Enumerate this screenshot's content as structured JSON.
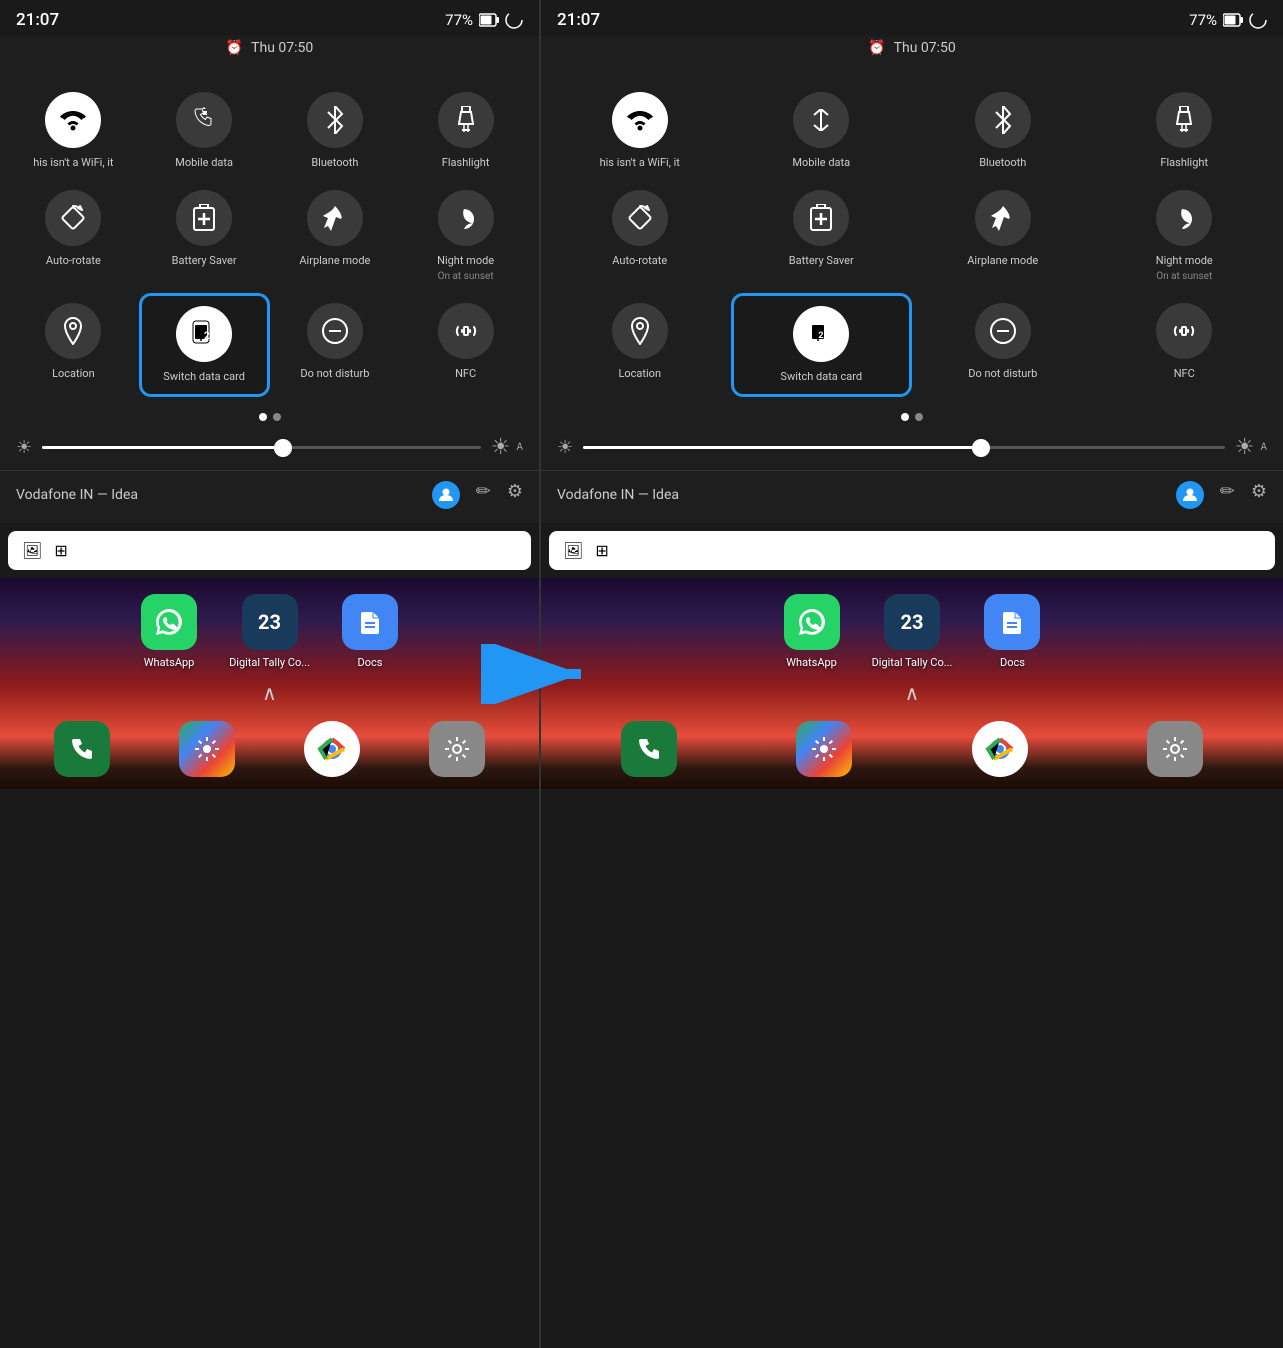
{
  "left": {
    "status": {
      "time": "21:07",
      "battery": "77%"
    },
    "alarm": {
      "time": "Thu 07:50"
    },
    "quickSettings": [
      {
        "id": "wifi",
        "icon": "wifi",
        "label": "his isn't a WiFi, it",
        "active": true
      },
      {
        "id": "mobile-data",
        "icon": "mobile",
        "label": "Mobile data",
        "active": false
      },
      {
        "id": "bluetooth",
        "icon": "bluetooth",
        "label": "Bluetooth",
        "active": false
      },
      {
        "id": "flashlight",
        "icon": "flashlight",
        "label": "Flashlight",
        "active": false
      },
      {
        "id": "auto-rotate",
        "icon": "rotate",
        "label": "Auto-rotate",
        "active": false
      },
      {
        "id": "battery-saver",
        "icon": "battery",
        "label": "Battery Saver",
        "active": false
      },
      {
        "id": "airplane",
        "icon": "airplane",
        "label": "Airplane mode",
        "active": false
      },
      {
        "id": "night-mode",
        "icon": "moon",
        "label": "Night mode",
        "sublabel": "On at sunset",
        "active": false
      },
      {
        "id": "location",
        "icon": "location",
        "label": "Location",
        "active": false
      },
      {
        "id": "switch-data",
        "icon": "sim",
        "label": "Switch data card",
        "active": true,
        "highlight": true
      },
      {
        "id": "dnd",
        "icon": "dnd",
        "label": "Do not disturb",
        "active": false
      },
      {
        "id": "nfc",
        "icon": "nfc",
        "label": "NFC",
        "active": false
      }
    ],
    "brightness": 55,
    "account": "Vodafone IN — Idea",
    "apps": [
      {
        "id": "whatsapp",
        "label": "WhatsApp"
      },
      {
        "id": "tally",
        "label": "Digital Tally Co..."
      },
      {
        "id": "docs",
        "label": "Docs"
      }
    ],
    "dock": [
      "Phone",
      "Photos",
      "Chrome",
      "Settings"
    ]
  },
  "right": {
    "status": {
      "time": "21:07",
      "battery": "77%"
    },
    "alarm": {
      "time": "Thu 07:50"
    },
    "quickSettings": [
      {
        "id": "wifi",
        "icon": "wifi",
        "label": "his isn't a WiFi, it",
        "active": true
      },
      {
        "id": "mobile-data",
        "icon": "mobile",
        "label": "Mobile data",
        "active": false
      },
      {
        "id": "bluetooth",
        "icon": "bluetooth",
        "label": "Bluetooth",
        "active": false
      },
      {
        "id": "flashlight",
        "icon": "flashlight",
        "label": "Flashlight",
        "active": false
      },
      {
        "id": "auto-rotate",
        "icon": "rotate",
        "label": "Auto-rotate",
        "active": false
      },
      {
        "id": "battery-saver",
        "icon": "battery",
        "label": "Battery Saver",
        "active": false
      },
      {
        "id": "airplane",
        "icon": "airplane",
        "label": "Airplane mode",
        "active": false
      },
      {
        "id": "night-mode",
        "icon": "moon",
        "label": "Night mode",
        "sublabel": "On at sunset",
        "active": false
      },
      {
        "id": "location",
        "icon": "location",
        "label": "Location",
        "active": false
      },
      {
        "id": "switch-data",
        "icon": "sim",
        "label": "Switch data card",
        "active": true,
        "highlight": true
      },
      {
        "id": "dnd",
        "icon": "dnd",
        "label": "Do not disturb",
        "active": false
      },
      {
        "id": "nfc",
        "icon": "nfc",
        "label": "NFC",
        "active": false
      }
    ],
    "brightness": 62,
    "account": "Vodafone IN — Idea",
    "apps": [
      {
        "id": "whatsapp",
        "label": "WhatsApp"
      },
      {
        "id": "tally",
        "label": "Digital Tally Co..."
      },
      {
        "id": "docs",
        "label": "Docs"
      }
    ],
    "dock": [
      "Phone",
      "Photos",
      "Chrome",
      "Settings"
    ]
  },
  "arrow": {
    "direction": "right",
    "color": "#2196F3"
  },
  "icons": {
    "wifi": "▼",
    "mobile": "↕",
    "bluetooth": "⚡",
    "flashlight": "🔦",
    "rotate": "⟳",
    "battery": "🔋",
    "airplane": "✈",
    "moon": "🌙",
    "location": "📍",
    "sim": "📱",
    "dnd": "⊖",
    "nfc": "N"
  }
}
